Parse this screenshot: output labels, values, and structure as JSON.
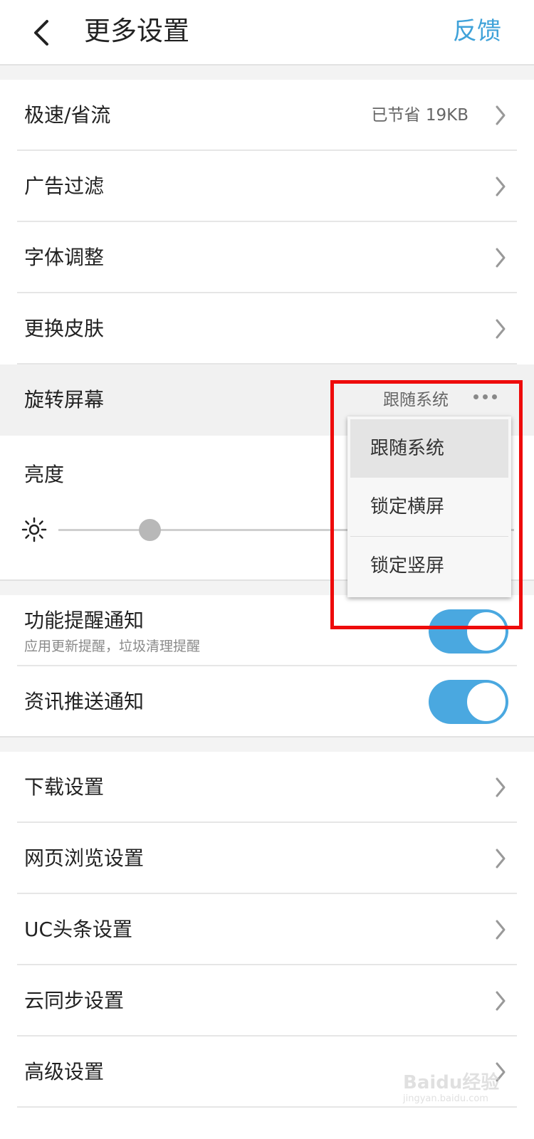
{
  "header": {
    "title": "更多设置",
    "feedback": "反馈"
  },
  "group1": {
    "rows": [
      {
        "label": "极速/省流",
        "value": "已节省  19KB"
      },
      {
        "label": "广告过滤"
      },
      {
        "label": "字体调整"
      },
      {
        "label": "更换皮肤"
      },
      {
        "label": "旋转屏幕",
        "value": "跟随系统"
      }
    ]
  },
  "brightness": {
    "label": "亮度",
    "level_fraction": 0.2
  },
  "rotate_menu": {
    "options": [
      "跟随系统",
      "锁定横屏",
      "锁定竖屏"
    ],
    "selected": "跟随系统"
  },
  "notifications": {
    "feature": {
      "label": "功能提醒通知",
      "sublabel": "应用更新提醒，垃圾清理提醒",
      "on": true
    },
    "news": {
      "label": "资讯推送通知",
      "on": true
    }
  },
  "group2": {
    "rows": [
      {
        "label": "下载设置"
      },
      {
        "label": "网页浏览设置"
      },
      {
        "label": "UC头条设置"
      },
      {
        "label": "云同步设置"
      },
      {
        "label": "高级设置"
      }
    ]
  },
  "watermark": {
    "logo": "Baidu经验",
    "url": "jingyan.baidu.com"
  },
  "colors": {
    "accent": "#3fa2d9",
    "toggle": "#4aa8e0",
    "highlight_box": "#ee0b0b"
  }
}
